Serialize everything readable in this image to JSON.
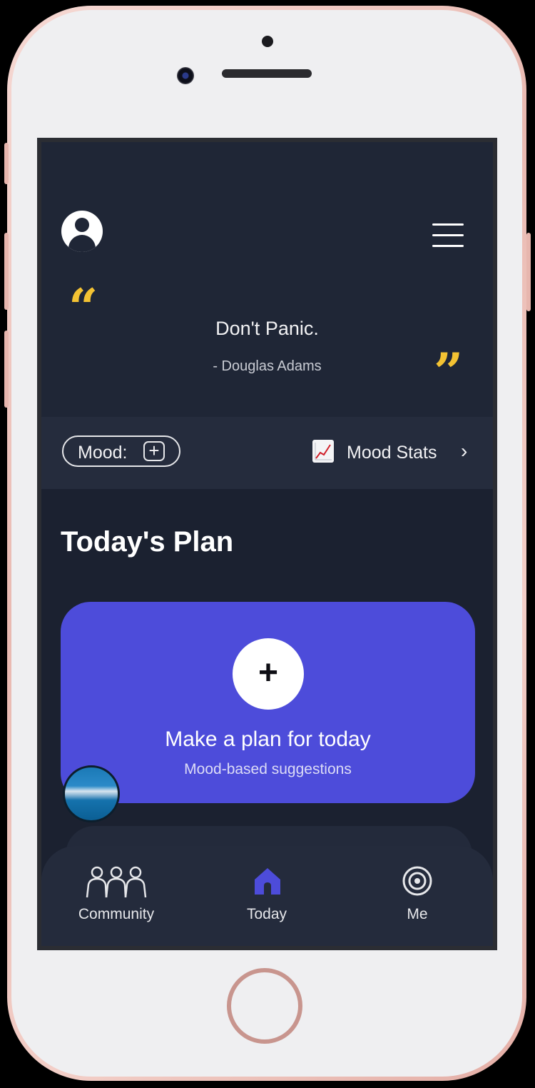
{
  "quote": {
    "text": "Don't Panic.",
    "author": "- Douglas Adams",
    "open_mark": "“",
    "close_mark": "”"
  },
  "mood": {
    "label": "Mood:",
    "add_glyph": "+",
    "stats_label": "Mood Stats",
    "stats_icon": "chart-increasing-icon",
    "chevron": "›"
  },
  "plan": {
    "title": "Today's Plan",
    "add_glyph": "+",
    "main_text": "Make a plan for today",
    "sub_text": "Mood-based suggestions"
  },
  "tabs": [
    {
      "label": "Community",
      "icon": "community-icon",
      "active": false
    },
    {
      "label": "Today",
      "icon": "home-icon",
      "active": true
    },
    {
      "label": "Me",
      "icon": "target-icon",
      "active": false
    }
  ],
  "colors": {
    "background": "#1e2535",
    "accent": "#4d4cda",
    "quote_marks": "#f3c233",
    "text": "#f2f2f4"
  }
}
